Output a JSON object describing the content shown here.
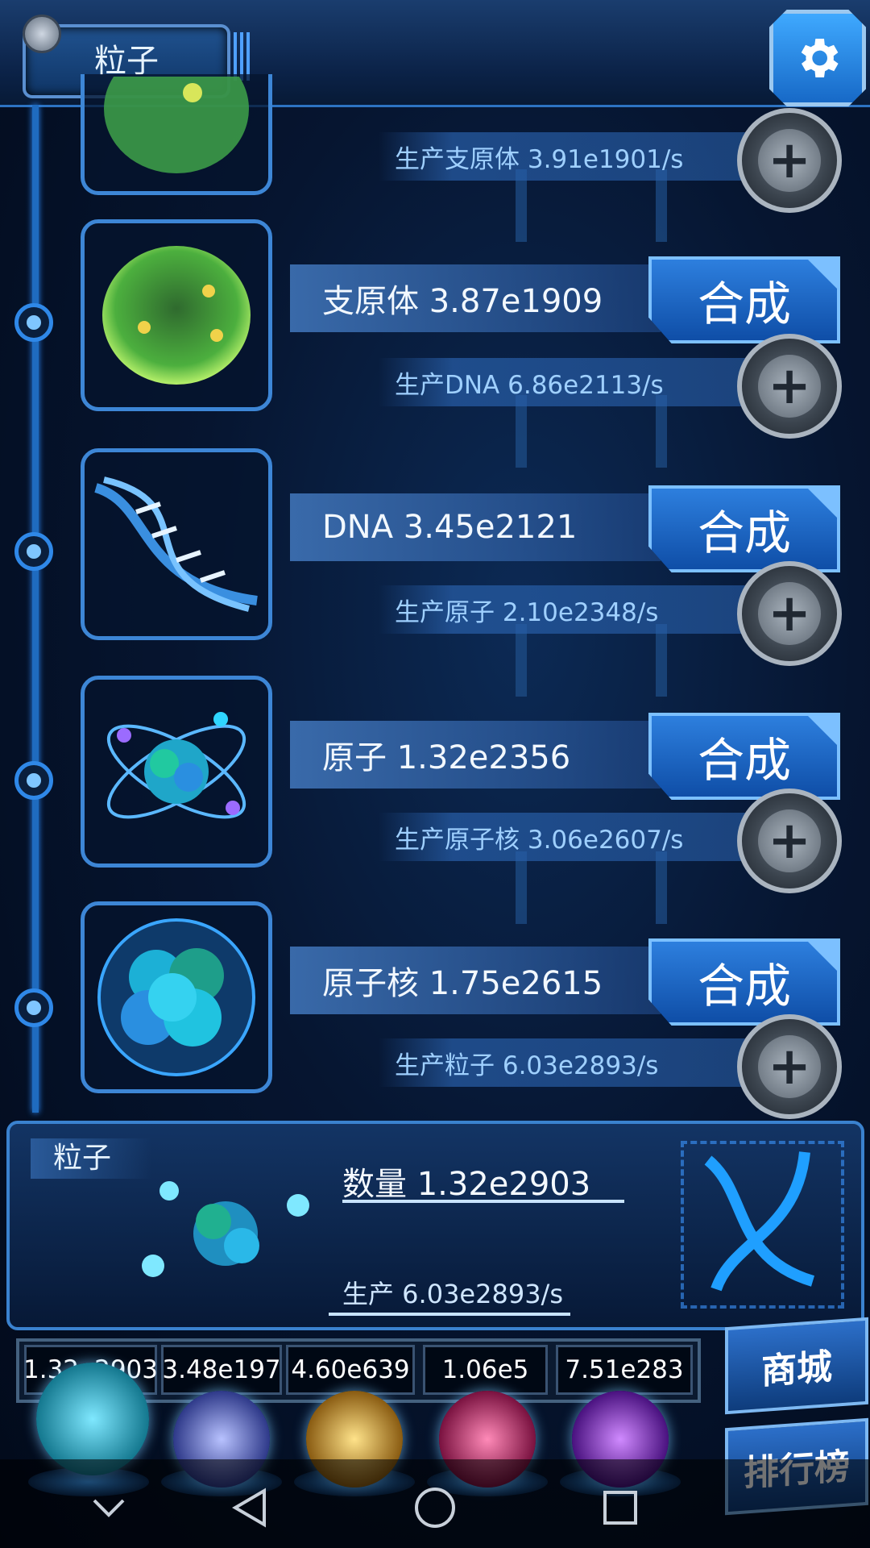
{
  "header": {
    "title": "粒子"
  },
  "items": [
    {
      "name": "",
      "production": "生产支原体 3.91e1901/s",
      "craft_label": ""
    },
    {
      "name": "支原体 3.87e1909",
      "production": "生产DNA 6.86e2113/s",
      "craft_label": "合成"
    },
    {
      "name": "DNA 3.45e2121",
      "production": "生产原子 2.10e2348/s",
      "craft_label": "合成"
    },
    {
      "name": "原子 1.32e2356",
      "production": "生产原子核 3.06e2607/s",
      "craft_label": "合成"
    },
    {
      "name": "原子核 1.75e2615",
      "production": "生产粒子 6.03e2893/s",
      "craft_label": "合成"
    }
  ],
  "panel": {
    "tag": "粒子",
    "quantity": "数量 1.32e2903",
    "production": "生产 6.03e2893/s"
  },
  "resources": [
    {
      "value": "1.32e2903",
      "orb_color": "#1fb8e0"
    },
    {
      "value": "3.48e197",
      "orb_color": "#5b6bd8"
    },
    {
      "value": "4.60e639",
      "orb_color": "#d9a036"
    },
    {
      "value": "1.06e5",
      "orb_color": "#e0337a"
    },
    {
      "value": "7.51e283",
      "orb_color": "#8b36d8"
    }
  ],
  "side_buttons": {
    "shop": "商城",
    "rank": "排行榜"
  },
  "colors": {
    "accent": "#2d7fde",
    "background": "#061530",
    "rail": "#1f6bbf"
  },
  "icons": {
    "settings": "gear-icon",
    "add": "plus-icon"
  }
}
